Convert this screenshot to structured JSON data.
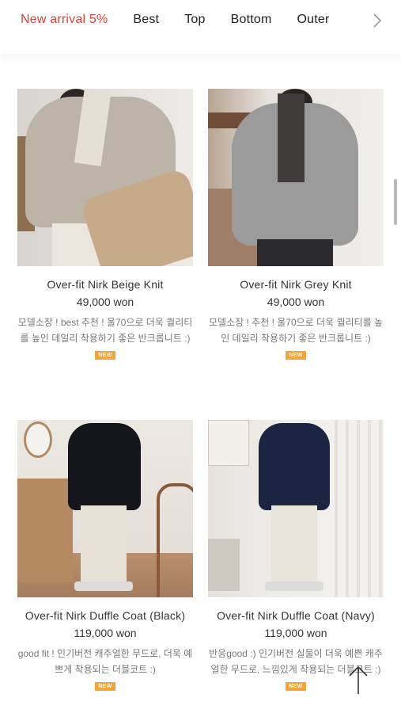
{
  "nav": {
    "items": [
      {
        "label": "New arrival 5%",
        "active": true
      },
      {
        "label": "Best",
        "active": false
      },
      {
        "label": "Top",
        "active": false
      },
      {
        "label": "Bottom",
        "active": false
      },
      {
        "label": "Outer",
        "active": false
      }
    ],
    "next_icon": "chevron-right-icon",
    "accent_color": "#d9433a"
  },
  "products": [
    {
      "name": "Over-fit Nirk Beige Knit",
      "price": "49,000 won",
      "description": "모델소장 ! best 추천 ! 울70으로 더욱 퀄리티를 높인 데일리 착용하기 좋은 반크롭니트 :)",
      "badge": "NEW"
    },
    {
      "name": "Over-fit Nirk Grey Knit",
      "price": "49,000 won",
      "description": "모델소장 ! 추천 ! 울70으로 더욱 퀄리티를 높인 데일리 착용하기 좋은 반크롭니트 :)",
      "badge": "NEW"
    },
    {
      "name": "Over-fit Nirk Duffle Coat (Black)",
      "price": "119,000 won",
      "description": "good fit ! 인기버전 캐주얼한 무드로, 더욱 예쁘게 착용되는 더블코트 :)",
      "badge": "NEW"
    },
    {
      "name": "Over-fit Nirk Duffle Coat (Navy)",
      "price": "119,000 won",
      "description": "반응good :) 인기버전 실물이 더욱 예쁜 캐주얼한 무드로, 느낌있게 착용되는 더블코트 :)",
      "badge": "NEW"
    }
  ],
  "badge_color": "#f3a43b",
  "scroll_top_icon": "arrow-up-icon"
}
